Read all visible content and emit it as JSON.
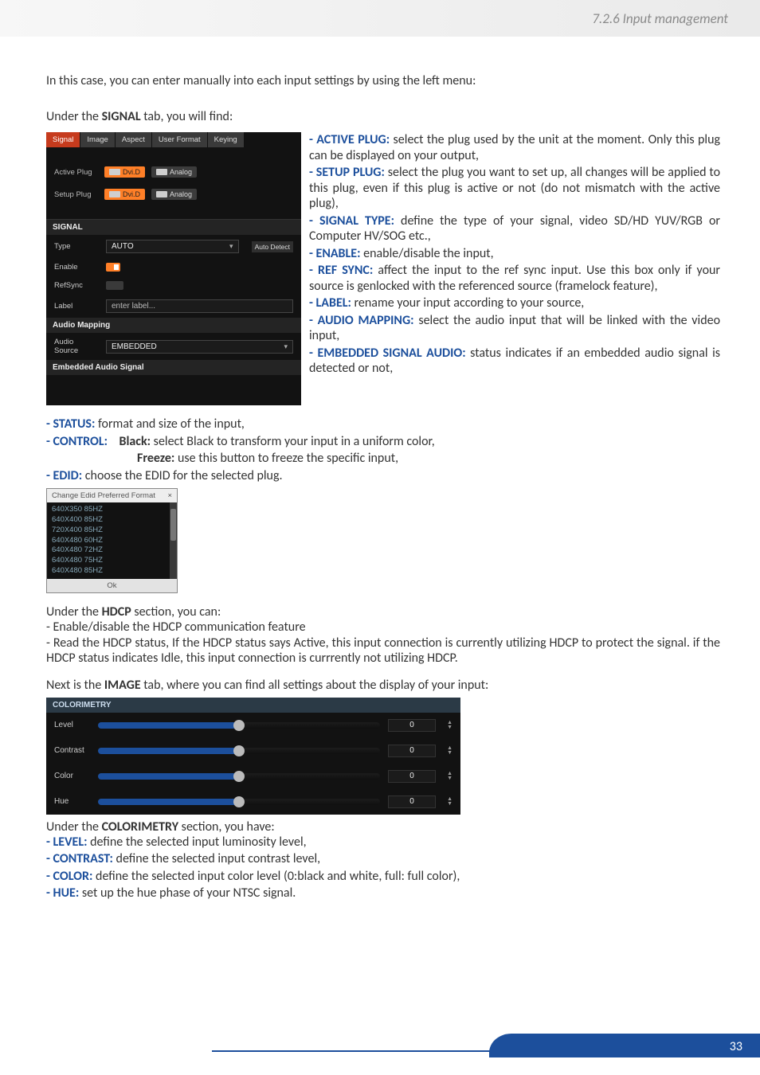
{
  "header": {
    "section": "7.2.6 Input management"
  },
  "intro": "In this case, you can enter manually into each input settings by using the left menu:",
  "under_signal": {
    "prefix": "Under the ",
    "bold": "SIGNAL",
    "suffix": " tab, you will find:"
  },
  "signal_panel": {
    "tabs": [
      "Signal",
      "Image",
      "Aspect",
      "User Format",
      "Keying"
    ],
    "active_tab": 0,
    "active_plug_label": "Active Plug",
    "setup_plug_label": "Setup Plug",
    "plug_dvid": "Dvi.D",
    "plug_analog": "Analog",
    "signal_header": "SIGNAL",
    "type_label": "Type",
    "type_value": "AUTO",
    "auto_detect": "Auto Detect",
    "enable_label": "Enable",
    "refsync_label": "RefSync",
    "label_label": "Label",
    "label_placeholder": "enter label...",
    "audio_mapping_header": "Audio Mapping",
    "audio_source_label": "Audio Source",
    "audio_source_value": "EMBEDDED",
    "embedded_audio_header": "Embedded Audio Signal"
  },
  "defs_right": [
    {
      "t": "ACTIVE PLUG:",
      "d": " select the plug used by the unit at the moment. Only this plug can be displayed on your output,"
    },
    {
      "t": "SETUP PLUG:",
      "d": " select the plug you want to set up, all changes will be applied to this plug, even if this plug is active or not (do not mismatch with the active plug),"
    },
    {
      "t": "SIGNAL TYPE:",
      "d": " define the type of your signal, video SD/HD YUV/RGB or Computer HV/SOG etc.,"
    },
    {
      "t": "ENABLE:",
      "d": " enable/disable the input,"
    },
    {
      "t": "REF SYNC:",
      "d": " affect the input to the ref sync input. Use this box only if your source is genlocked with the referenced source (framelock feature),"
    },
    {
      "t": "LABEL:",
      "d": " rename your input according to your source,"
    },
    {
      "t": "AUDIO MAPPING:",
      "d": " select the audio input that will be linked with the video input,"
    },
    {
      "t": "EMBEDDED SIGNAL AUDIO:",
      "d": " status indicates if an embedded audio signal is detected or not,"
    }
  ],
  "status": {
    "t": "STATUS:",
    "d": " format and size of the input,"
  },
  "control": {
    "t": "CONTROL:",
    "black_b": "Black:",
    "black_d": " select Black to transform your input in a uniform color,",
    "freeze_b": "Freeze:",
    "freeze_d": " use this button to freeze the specific input,"
  },
  "edid": {
    "t": "EDID:",
    "d": " choose the EDID for the selected plug."
  },
  "edid_modal": {
    "title": "Change Edid Preferred Format",
    "items": [
      "640X350 85HZ",
      "640X400 85HZ",
      "720X400 85HZ",
      "640X480 60HZ",
      "640X480 72HZ",
      "640X480 75HZ",
      "640X480 85HZ"
    ],
    "ok": "Ok"
  },
  "under_hdcp": {
    "prefix": "Under the ",
    "bold": "HDCP",
    "suffix": " section, you can:"
  },
  "hdcp_lines": [
    "- Enable/disable the HDCP communication feature",
    "- Read the HDCP status, If the HDCP status says Active, this input connection is currently utilizing HDCP to protect the signal. if the HDCP status indicates Idle, this input connection is currrently not utilizing HDCP."
  ],
  "next_image": {
    "prefix": "Next is the ",
    "bold": "IMAGE",
    "suffix": " tab, where you can find all settings about the display of your input:"
  },
  "colorimetry": {
    "header": "COLORIMETRY",
    "rows": [
      {
        "label": "Level",
        "value": "0"
      },
      {
        "label": "Contrast",
        "value": "0"
      },
      {
        "label": "Color",
        "value": "0"
      },
      {
        "label": "Hue",
        "value": "0"
      }
    ]
  },
  "under_colo": {
    "prefix": "Under the ",
    "bold": "COLORIMETRY",
    "suffix": " section, you have:"
  },
  "colo_defs": [
    {
      "t": "LEVEL:",
      "d": " define the selected input luminosity level,"
    },
    {
      "t": "CONTRAST:",
      "d": " define the selected input contrast level,"
    },
    {
      "t": "COLOR:",
      "d": " define the selected input color level (0:black and white, full: full color),"
    },
    {
      "t": "HUE:",
      "d": " set up the hue phase of your NTSC signal."
    }
  ],
  "page_num": "33"
}
